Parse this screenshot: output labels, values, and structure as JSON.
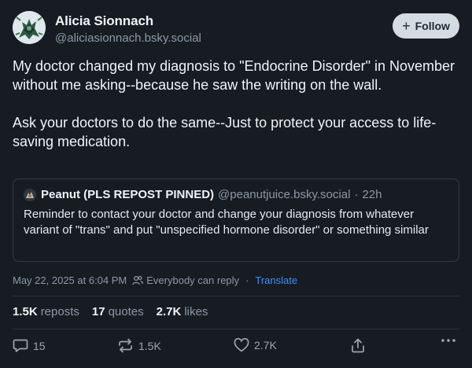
{
  "author": {
    "name": "Alicia Sionnach",
    "handle": "@aliciasionnach.bsky.social"
  },
  "follow_button": {
    "icon": "plus-icon",
    "label": "Follow"
  },
  "post": {
    "paragraphs": [
      "My doctor changed my diagnosis to \"Endocrine Disorder\" in November without me asking--because he saw the writing on the wall.",
      "Ask your doctors to do the same--Just to protect your access to life-saving medication."
    ]
  },
  "quoted_post": {
    "name": "Peanut (PLS REPOST PINNED)",
    "handle": "@peanutjuice.bsky.social",
    "separator": "·",
    "time": "22h",
    "text": "Reminder to contact your doctor and change your diagnosis from whatever variant of \"trans\" and put \"unspecified hormone disorder\" or something similar"
  },
  "meta": {
    "timestamp": "May 22, 2025 at 6:04 PM",
    "reply_setting": "Everybody can reply",
    "separator": "·",
    "translate": "Translate"
  },
  "stats": {
    "reposts_count": "1.5K",
    "reposts_label": "reposts",
    "quotes_count": "17",
    "quotes_label": "quotes",
    "likes_count": "2.7K",
    "likes_label": "likes"
  },
  "actions": {
    "reply_count": "15",
    "repost_count": "1.5K",
    "like_count": "2.7K"
  },
  "colors": {
    "background": "#171c23",
    "text": "#f1f3f5",
    "muted": "#8b98a5",
    "link": "#3e8ef7",
    "follow_bg": "#d5dbe2",
    "border": "#2f3a47"
  }
}
